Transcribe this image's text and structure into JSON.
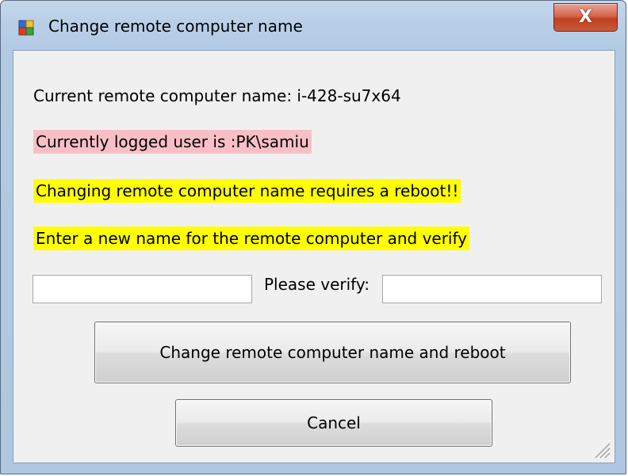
{
  "window": {
    "title": "Change remote computer name",
    "close_label": "X"
  },
  "labels": {
    "current_name": "Current remote computer name: i-428-su7x64",
    "logged_user": "Currently logged user is :PK\\samiu",
    "reboot_warning": "Changing remote computer name requires a reboot!!",
    "enter_instruction": "Enter a new name for the remote computer and verify",
    "verify": "Please verify:"
  },
  "inputs": {
    "new_name": {
      "value": "",
      "placeholder": ""
    },
    "verify_name": {
      "value": "",
      "placeholder": ""
    }
  },
  "buttons": {
    "change_reboot": "Change remote computer name and reboot",
    "cancel": "Cancel"
  },
  "colors": {
    "logged_user_highlight": "#f9bfc6",
    "warning_highlight": "#ffff00",
    "close_button": "#c1401e",
    "dialog_background": "#f0f0f0"
  },
  "icons": {
    "app": "application-window-icon",
    "close": "close-icon",
    "resize": "resize-grip-icon"
  }
}
